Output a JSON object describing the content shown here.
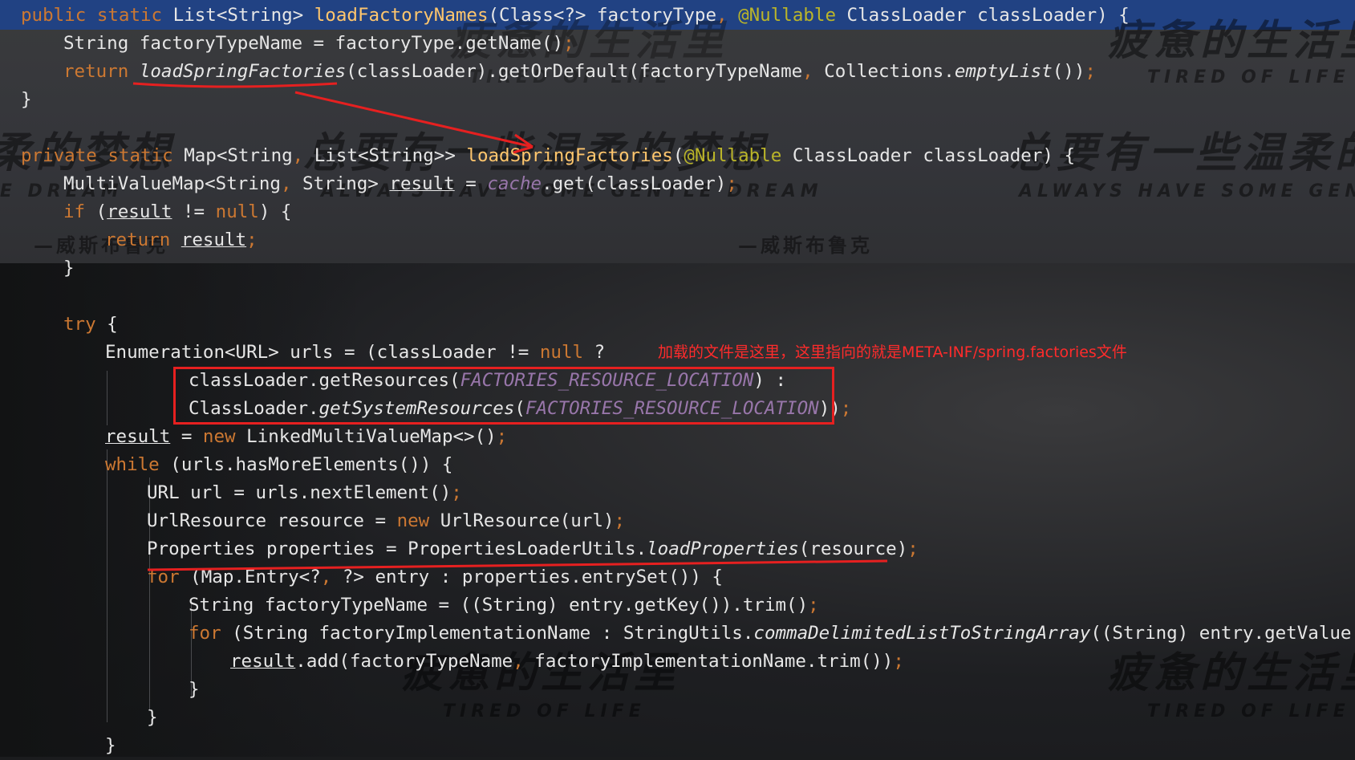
{
  "code_lines": [
    "public static List<String> loadFactoryNames(Class<?> factoryType, @Nullable ClassLoader classLoader) {",
    "String factoryTypeName = factoryType.getName();",
    "return loadSpringFactories(classLoader).getOrDefault(factoryTypeName, Collections.emptyList());",
    "}",
    "private static Map<String, List<String>> loadSpringFactories(@Nullable ClassLoader classLoader) {",
    "MultiValueMap<String, String> result = cache.get(classLoader);",
    "if (result != null) {",
    "return result;",
    "}",
    "try {",
    "Enumeration<URL> urls = (classLoader != null ?",
    "classLoader.getResources(FACTORIES_RESOURCE_LOCATION) :",
    "ClassLoader.getSystemResources(FACTORIES_RESOURCE_LOCATION));",
    "result = new LinkedMultiValueMap<>();",
    "while (urls.hasMoreElements()) {",
    "URL url = urls.nextElement();",
    "UrlResource resource = new UrlResource(url);",
    "Properties properties = PropertiesLoaderUtils.loadProperties(resource);",
    "for (Map.Entry<?, ?> entry : properties.entrySet()) {",
    "String factoryTypeName = ((String) entry.getKey()).trim();",
    "for (String factoryImplementationName : StringUtils.commaDelimitedListToStringArray((String) entry.getValue()))",
    "result.add(factoryTypeName, factoryImplementationName.trim());",
    "}",
    "}",
    "}"
  ],
  "annotation": {
    "text": "加载的文件是这里，这里指向的就是META-INF/spring.factories文件",
    "color": "#ff2b2b"
  },
  "watermarks": {
    "line_cn_1": "疲惫的生活里",
    "line_en_1": "TIRED OF LIFE",
    "line_cn_2": "总要有一些温柔的梦想",
    "line_en_2": "ALWAYS HAVE SOME GENTLE DREAM",
    "signature": "—威斯布鲁克"
  },
  "colors": {
    "keyword": "#cc7832",
    "method_declaration": "#ffc66d",
    "annotation": "#bbb529",
    "static_field": "#9876aa",
    "line_highlight": "#214283",
    "markup_red": "#e62020"
  }
}
